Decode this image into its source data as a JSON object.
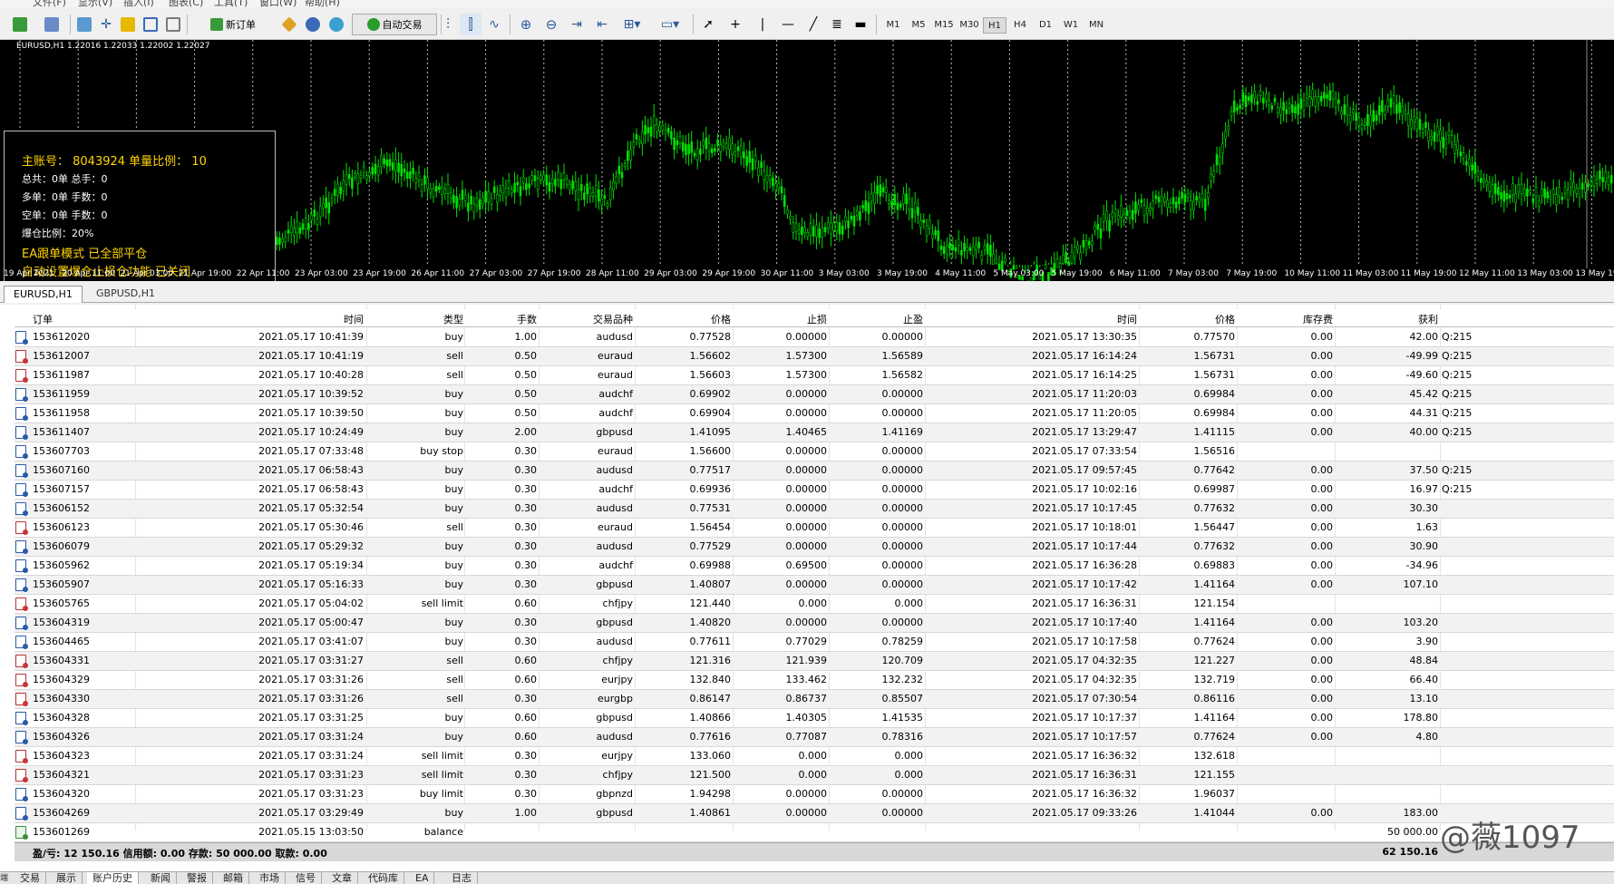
{
  "menubar": [
    "文件(F)",
    "显示(V)",
    "插入(I)",
    "图表(C)",
    "工具(T)",
    "窗口(W)",
    "帮助(H)"
  ],
  "toolbar": {
    "new_order": "新订单",
    "auto_trading": "自动交易",
    "timeframes": [
      "M1",
      "M5",
      "M15",
      "M30",
      "H1",
      "H4",
      "D1",
      "W1",
      "MN"
    ],
    "active_timeframe": "H1"
  },
  "chart": {
    "title": "EURUSD,H1  1.22016 1.22033 1.22002 1.22027",
    "info": {
      "line1": "主账号： 8043924   单量比例： 10",
      "line2": "总共：0单   总手：0",
      "line3": "多单：0单   手数：0",
      "line4": "空单：0单   手数：0",
      "line5": "爆仓比例：20%",
      "line6": "EA跟单模式 已全部平仓",
      "line7": "自动设置爆仓止损仓功能 已关闭"
    },
    "dates": [
      "19 Apr 2021",
      "20 Apr 11:00",
      "21 Apr 03:00",
      "21 Apr 19:00",
      "22 Apr 11:00",
      "23 Apr 03:00",
      "23 Apr 19:00",
      "26 Apr 11:00",
      "27 Apr 03:00",
      "27 Apr 19:00",
      "28 Apr 11:00",
      "29 Apr 03:00",
      "29 Apr 19:00",
      "30 Apr 11:00",
      "3 May 03:00",
      "3 May 19:00",
      "4 May 11:00",
      "5 May 03:00",
      "5 May 19:00",
      "6 May 11:00",
      "7 May 03:00",
      "7 May 19:00",
      "10 May 11:00",
      "11 May 03:00",
      "11 May 19:00",
      "12 May 11:00",
      "13 May 03:00",
      "13 May 19:00"
    ]
  },
  "chart_tabs": [
    "EURUSD,H1",
    "GBPUSD,H1"
  ],
  "table": {
    "headers": [
      "订单",
      "时间",
      "类型",
      "手数",
      "交易品种",
      "价格",
      "止损",
      "止盈",
      "时间",
      "价格",
      "库存费",
      "获利"
    ],
    "rows": [
      [
        "153612020",
        "2021.05.17 10:41:39",
        "buy",
        "1.00",
        "audusd",
        "0.77528",
        "0.00000",
        "0.00000",
        "2021.05.17 13:30:35",
        "0.77570",
        "0.00",
        "42.00",
        "Q:215"
      ],
      [
        "153612007",
        "2021.05.17 10:41:19",
        "sell",
        "0.50",
        "euraud",
        "1.56602",
        "1.57300",
        "1.56589",
        "2021.05.17 16:14:24",
        "1.56731",
        "0.00",
        "-49.99",
        "Q:215"
      ],
      [
        "153611987",
        "2021.05.17 10:40:28",
        "sell",
        "0.50",
        "euraud",
        "1.56603",
        "1.57300",
        "1.56582",
        "2021.05.17 16:14:25",
        "1.56731",
        "0.00",
        "-49.60",
        "Q:215"
      ],
      [
        "153611959",
        "2021.05.17 10:39:52",
        "buy",
        "0.50",
        "audchf",
        "0.69902",
        "0.00000",
        "0.00000",
        "2021.05.17 11:20:03",
        "0.69984",
        "0.00",
        "45.42",
        "Q:215"
      ],
      [
        "153611958",
        "2021.05.17 10:39:50",
        "buy",
        "0.50",
        "audchf",
        "0.69904",
        "0.00000",
        "0.00000",
        "2021.05.17 11:20:05",
        "0.69984",
        "0.00",
        "44.31",
        "Q:215"
      ],
      [
        "153611407",
        "2021.05.17 10:24:49",
        "buy",
        "2.00",
        "gbpusd",
        "1.41095",
        "1.40465",
        "1.41169",
        "2021.05.17 13:29:47",
        "1.41115",
        "0.00",
        "40.00",
        "Q:215"
      ],
      [
        "153607703",
        "2021.05.17 07:33:48",
        "buy stop",
        "0.30",
        "euraud",
        "1.56600",
        "0.00000",
        "0.00000",
        "2021.05.17 07:33:54",
        "1.56516",
        "",
        "",
        ""
      ],
      [
        "153607160",
        "2021.05.17 06:58:43",
        "buy",
        "0.30",
        "audusd",
        "0.77517",
        "0.00000",
        "0.00000",
        "2021.05.17 09:57:45",
        "0.77642",
        "0.00",
        "37.50",
        "Q:215"
      ],
      [
        "153607157",
        "2021.05.17 06:58:43",
        "buy",
        "0.30",
        "audchf",
        "0.69936",
        "0.00000",
        "0.00000",
        "2021.05.17 10:02:16",
        "0.69987",
        "0.00",
        "16.97",
        "Q:215"
      ],
      [
        "153606152",
        "2021.05.17 05:32:54",
        "buy",
        "0.30",
        "audusd",
        "0.77531",
        "0.00000",
        "0.00000",
        "2021.05.17 10:17:45",
        "0.77632",
        "0.00",
        "30.30",
        ""
      ],
      [
        "153606123",
        "2021.05.17 05:30:46",
        "sell",
        "0.30",
        "euraud",
        "1.56454",
        "0.00000",
        "0.00000",
        "2021.05.17 10:18:01",
        "1.56447",
        "0.00",
        "1.63",
        ""
      ],
      [
        "153606079",
        "2021.05.17 05:29:32",
        "buy",
        "0.30",
        "audusd",
        "0.77529",
        "0.00000",
        "0.00000",
        "2021.05.17 10:17:44",
        "0.77632",
        "0.00",
        "30.90",
        ""
      ],
      [
        "153605962",
        "2021.05.17 05:19:34",
        "buy",
        "0.30",
        "audchf",
        "0.69988",
        "0.69500",
        "0.00000",
        "2021.05.17 16:36:28",
        "0.69883",
        "0.00",
        "-34.96",
        ""
      ],
      [
        "153605907",
        "2021.05.17 05:16:33",
        "buy",
        "0.30",
        "gbpusd",
        "1.40807",
        "0.00000",
        "0.00000",
        "2021.05.17 10:17:42",
        "1.41164",
        "0.00",
        "107.10",
        ""
      ],
      [
        "153605765",
        "2021.05.17 05:04:02",
        "sell limit",
        "0.60",
        "chfjpy",
        "121.440",
        "0.000",
        "0.000",
        "2021.05.17 16:36:31",
        "121.154",
        "",
        "",
        ""
      ],
      [
        "153604319",
        "2021.05.17 05:00:47",
        "buy",
        "0.30",
        "gbpusd",
        "1.40820",
        "0.00000",
        "0.00000",
        "2021.05.17 10:17:40",
        "1.41164",
        "0.00",
        "103.20",
        ""
      ],
      [
        "153604465",
        "2021.05.17 03:41:07",
        "buy",
        "0.30",
        "audusd",
        "0.77611",
        "0.77029",
        "0.78259",
        "2021.05.17 10:17:58",
        "0.77624",
        "0.00",
        "3.90",
        ""
      ],
      [
        "153604331",
        "2021.05.17 03:31:27",
        "sell",
        "0.60",
        "chfjpy",
        "121.316",
        "121.939",
        "120.709",
        "2021.05.17 04:32:35",
        "121.227",
        "0.00",
        "48.84",
        ""
      ],
      [
        "153604329",
        "2021.05.17 03:31:26",
        "sell",
        "0.60",
        "eurjpy",
        "132.840",
        "133.462",
        "132.232",
        "2021.05.17 04:32:35",
        "132.719",
        "0.00",
        "66.40",
        ""
      ],
      [
        "153604330",
        "2021.05.17 03:31:26",
        "sell",
        "0.30",
        "eurgbp",
        "0.86147",
        "0.86737",
        "0.85507",
        "2021.05.17 07:30:54",
        "0.86116",
        "0.00",
        "13.10",
        ""
      ],
      [
        "153604328",
        "2021.05.17 03:31:25",
        "buy",
        "0.60",
        "gbpusd",
        "1.40866",
        "1.40305",
        "1.41535",
        "2021.05.17 10:17:37",
        "1.41164",
        "0.00",
        "178.80",
        ""
      ],
      [
        "153604326",
        "2021.05.17 03:31:24",
        "buy",
        "0.60",
        "audusd",
        "0.77616",
        "0.77087",
        "0.78316",
        "2021.05.17 10:17:57",
        "0.77624",
        "0.00",
        "4.80",
        ""
      ],
      [
        "153604323",
        "2021.05.17 03:31:24",
        "sell limit",
        "0.30",
        "eurjpy",
        "133.060",
        "0.000",
        "0.000",
        "2021.05.17 16:36:32",
        "132.618",
        "",
        "",
        ""
      ],
      [
        "153604321",
        "2021.05.17 03:31:23",
        "sell limit",
        "0.30",
        "chfjpy",
        "121.500",
        "0.000",
        "0.000",
        "2021.05.17 16:36:31",
        "121.155",
        "",
        "",
        ""
      ],
      [
        "153604320",
        "2021.05.17 03:31:23",
        "buy limit",
        "0.30",
        "gbpnzd",
        "1.94298",
        "0.00000",
        "0.00000",
        "2021.05.17 16:36:32",
        "1.96037",
        "",
        "",
        ""
      ],
      [
        "153604269",
        "2021.05.17 03:29:49",
        "buy",
        "1.00",
        "gbpusd",
        "1.40861",
        "0.00000",
        "0.00000",
        "2021.05.17 09:33:26",
        "1.41044",
        "0.00",
        "183.00",
        ""
      ],
      [
        "153601269",
        "2021.05.15 13:03:50",
        "balance",
        "",
        "",
        "",
        "",
        "",
        "",
        "",
        "",
        "50 000.00",
        ""
      ]
    ],
    "summary_left": "盈/亏: 12 150.16  信用额: 0.00  存款: 50 000.00  取款: 0.00",
    "summary_right": "62 150.16"
  },
  "watermark": "@薇1097",
  "bottom_tabs": [
    "交易",
    "展示",
    "账户历史",
    "新闻",
    "警报",
    "邮箱",
    "市场",
    "信号",
    "文章",
    "代码库",
    "EA",
    "日志"
  ],
  "active_bottom_tab": "账户历史",
  "side_label": "端"
}
